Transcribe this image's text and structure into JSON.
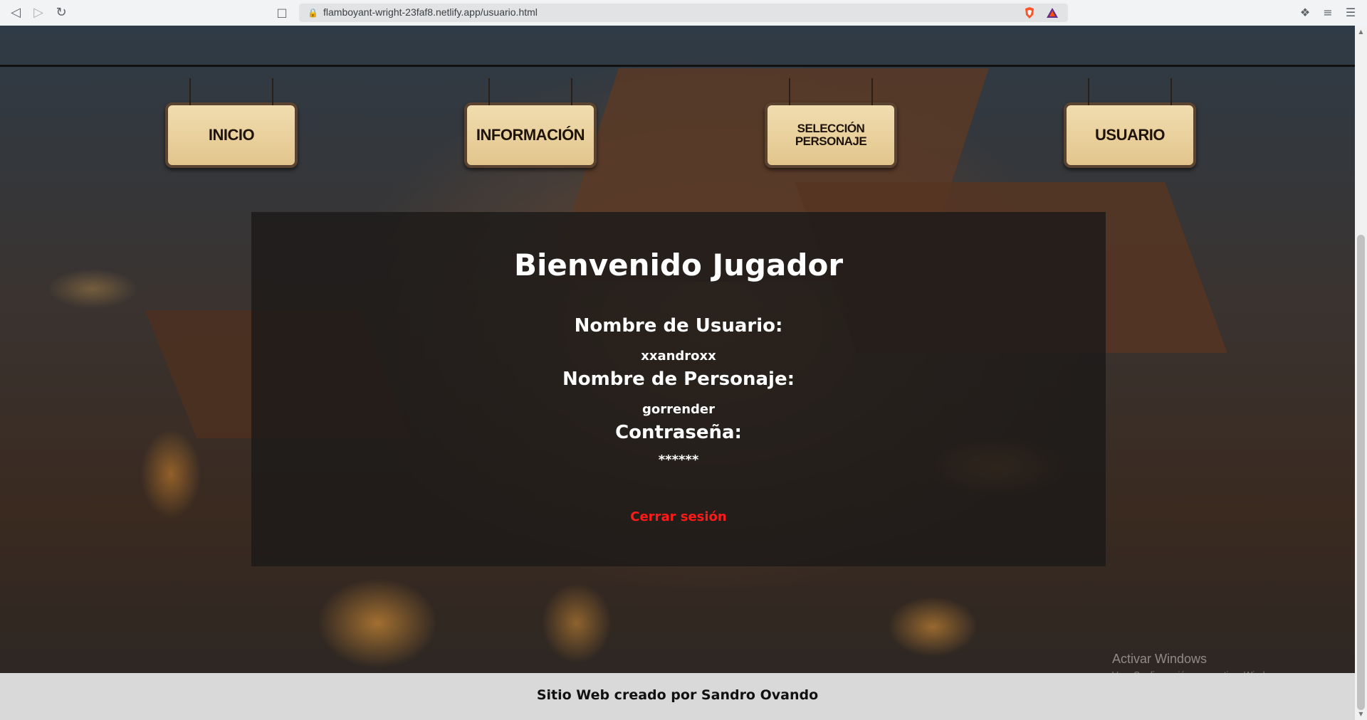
{
  "browser": {
    "url": "flamboyant-wright-23faf8.netlify.app/usuario.html",
    "icons": {
      "back": "back-arrow-icon",
      "forward": "forward-arrow-icon",
      "reload": "reload-icon",
      "bookmark": "bookmark-icon",
      "lock": "lock-icon",
      "brave": "brave-shield-icon",
      "rewards": "brave-rewards-icon",
      "extensions": "puzzle-icon",
      "playlist": "playlist-icon",
      "menu": "menu-icon"
    }
  },
  "nav": {
    "items": [
      {
        "label": "INICIO"
      },
      {
        "label": "INFORMACIÓN"
      },
      {
        "label_line1": "SELECCIÓN",
        "label_line2": "PERSONAJE"
      },
      {
        "label": "USUARIO"
      }
    ]
  },
  "profile": {
    "title": "Bienvenido Jugador",
    "username_label": "Nombre de Usuario:",
    "username_value": "xxandroxx",
    "character_label": "Nombre de Personaje:",
    "character_value": "gorrender",
    "password_label": "Contraseña:",
    "password_value": "******",
    "logout_label": "Cerrar sesión"
  },
  "watermark": {
    "line1": "Activar Windows",
    "line2": "Ve a Configuración para activar Windows."
  },
  "footer": {
    "text": "Sitio Web creado por Sandro Ovando"
  },
  "colors": {
    "logout": "#ff1a1a",
    "sign_wood": "#e9d09c",
    "footer_bg": "#d9d9d9"
  }
}
